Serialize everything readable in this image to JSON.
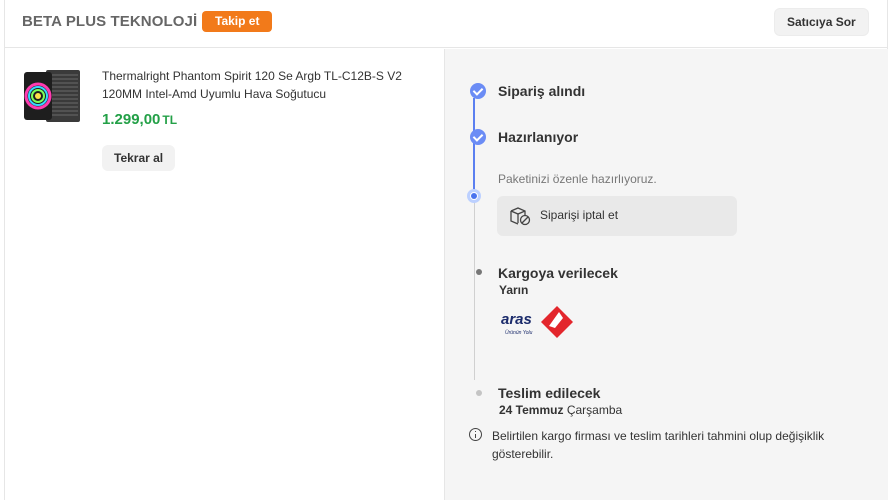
{
  "header": {
    "seller_name": "BETA PLUS TEKNOLOJİ",
    "follow_label": "Takip et",
    "ask_seller_label": "Satıcıya Sor"
  },
  "product": {
    "title": "Thermalright Phantom Spirit 120 Se Argb TL-C12B-S V2 120MM Intel-Amd Uyumlu Hava Soğutucu",
    "price": "1.299,00",
    "currency": "TL",
    "reorder_label": "Tekrar al",
    "image_icon": "cpu-cooler-image"
  },
  "timeline": {
    "steps": [
      {
        "title": "Sipariş alındı",
        "status": "done"
      },
      {
        "title": "Hazırlanıyor",
        "status": "done"
      },
      {
        "title": "Kargoya verilecek",
        "status": "pending",
        "subtitle": "Yarın"
      },
      {
        "title": "Teslim edilecek",
        "status": "pending",
        "date_bold": "24 Temmuz",
        "date_day": "Çarşamba"
      }
    ],
    "preparing_note": "Paketinizi özenle hazırlıyoruz.",
    "cancel_label": "Siparişi iptal et",
    "carrier": {
      "name": "aras",
      "tagline": "Ürünün Yolu"
    },
    "disclaimer": "Belirtilen kargo firması ve teslim tarihleri tahmini olup değişiklik gösterebilir."
  },
  "colors": {
    "accent_orange": "#f27a1a",
    "price_green": "#23a047",
    "timeline_blue": "#5b7ff0",
    "aras_red": "#e3262c",
    "aras_navy": "#1b2b6b"
  }
}
